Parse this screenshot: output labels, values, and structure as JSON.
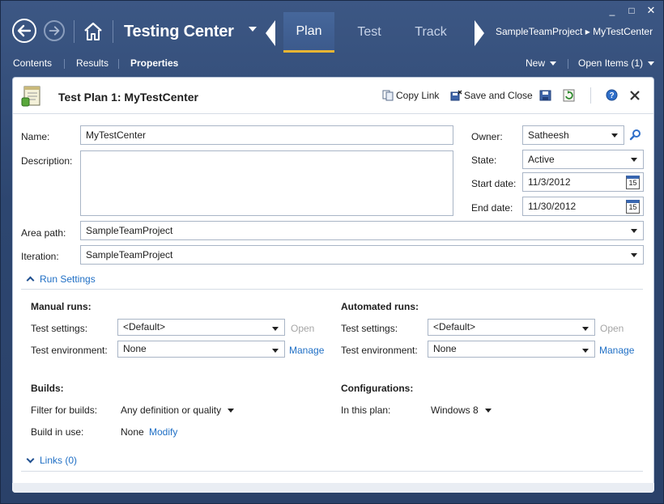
{
  "window": {
    "minimize": "_",
    "maximize": "□",
    "close": "✕"
  },
  "header": {
    "title": "Testing Center",
    "tabs": [
      {
        "label": "Plan"
      },
      {
        "label": "Test"
      },
      {
        "label": "Track"
      }
    ],
    "breadcrumb": "SampleTeamProject ▸ MyTestCenter"
  },
  "subnav": {
    "items": [
      {
        "label": "Contents"
      },
      {
        "label": "Results"
      },
      {
        "label": "Properties"
      }
    ],
    "new_label": "New",
    "open_items_label": "Open Items (1)"
  },
  "panel": {
    "title": "Test Plan 1: MyTestCenter",
    "toolbar": {
      "copy_link": "Copy Link",
      "save_close": "Save and Close"
    }
  },
  "form": {
    "name_label": "Name:",
    "name_value": "MyTestCenter",
    "description_label": "Description:",
    "description_value": "",
    "owner_label": "Owner:",
    "owner_value": "Satheesh",
    "state_label": "State:",
    "state_value": "Active",
    "start_label": "Start date:",
    "start_value": "11/3/2012",
    "end_label": "End date:",
    "end_value": "11/30/2012",
    "calendar_day": "15",
    "area_label": "Area path:",
    "area_value": "SampleTeamProject",
    "iteration_label": "Iteration:",
    "iteration_value": "SampleTeamProject"
  },
  "run_settings": {
    "header": "Run Settings",
    "manual": {
      "heading": "Manual runs:",
      "test_settings_label": "Test settings:",
      "test_settings_value": "<Default>",
      "open_label": "Open",
      "env_label": "Test environment:",
      "env_value": "None",
      "manage_label": "Manage"
    },
    "automated": {
      "heading": "Automated runs:",
      "test_settings_label": "Test settings:",
      "test_settings_value": "<Default>",
      "open_label": "Open",
      "env_label": "Test environment:",
      "env_value": "None",
      "manage_label": "Manage"
    },
    "builds": {
      "heading": "Builds:",
      "filter_label": "Filter for builds:",
      "filter_value": "Any definition or quality",
      "in_use_label": "Build in use:",
      "in_use_value": "None",
      "modify_label": "Modify"
    },
    "configurations": {
      "heading": "Configurations:",
      "in_plan_label": "In this plan:",
      "in_plan_value": "Windows 8"
    }
  },
  "links": {
    "header": "Links (0)"
  },
  "colors": {
    "accent": "#e8b533",
    "link": "#1f6fc5",
    "header_bg": "#2d4670"
  }
}
